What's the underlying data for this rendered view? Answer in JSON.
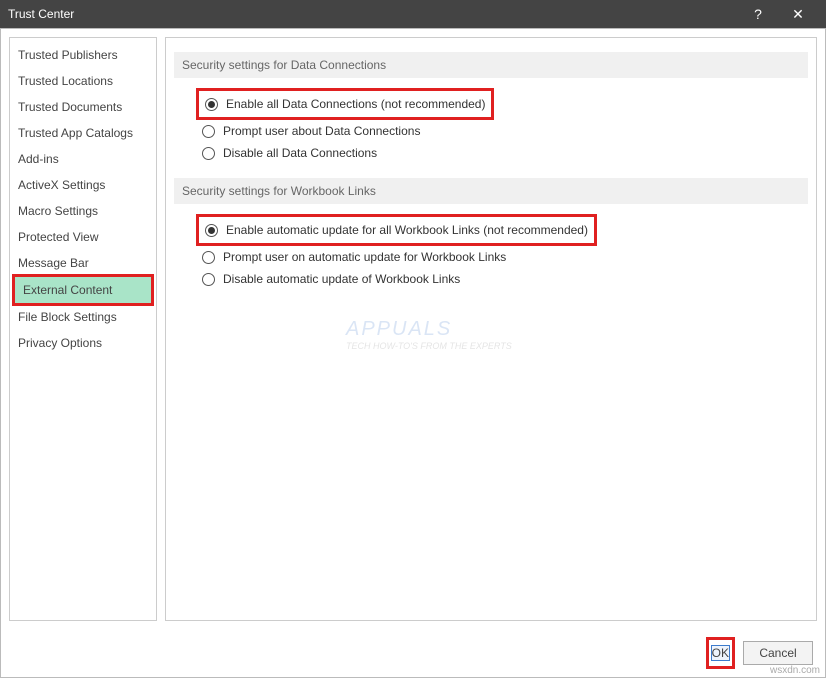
{
  "titlebar": {
    "title": "Trust Center"
  },
  "sidebar": {
    "items": [
      {
        "label": "Trusted Publishers"
      },
      {
        "label": "Trusted Locations"
      },
      {
        "label": "Trusted Documents"
      },
      {
        "label": "Trusted App Catalogs"
      },
      {
        "label": "Add-ins"
      },
      {
        "label": "ActiveX Settings"
      },
      {
        "label": "Macro Settings"
      },
      {
        "label": "Protected View"
      },
      {
        "label": "Message Bar"
      },
      {
        "label": "External Content",
        "selected": true
      },
      {
        "label": "File Block Settings"
      },
      {
        "label": "Privacy Options"
      }
    ]
  },
  "sections": {
    "dataConnections": {
      "header": "Security settings for Data Connections",
      "options": [
        {
          "label": "Enable all Data Connections (not recommended)",
          "checked": true,
          "highlighted": true
        },
        {
          "label": "Prompt user about Data Connections",
          "checked": false
        },
        {
          "label": "Disable all Data Connections",
          "checked": false
        }
      ]
    },
    "workbookLinks": {
      "header": "Security settings for Workbook Links",
      "options": [
        {
          "label": "Enable automatic update for all Workbook Links (not recommended)",
          "checked": true,
          "highlighted": true
        },
        {
          "label": "Prompt user on automatic update for Workbook Links",
          "checked": false
        },
        {
          "label": "Disable automatic update of Workbook Links",
          "checked": false
        }
      ]
    }
  },
  "footer": {
    "ok": "OK",
    "cancel": "Cancel"
  },
  "watermark": {
    "main": "APPUALS",
    "sub": "TECH HOW-TO'S FROM THE EXPERTS"
  },
  "credit": "wsxdn.com"
}
